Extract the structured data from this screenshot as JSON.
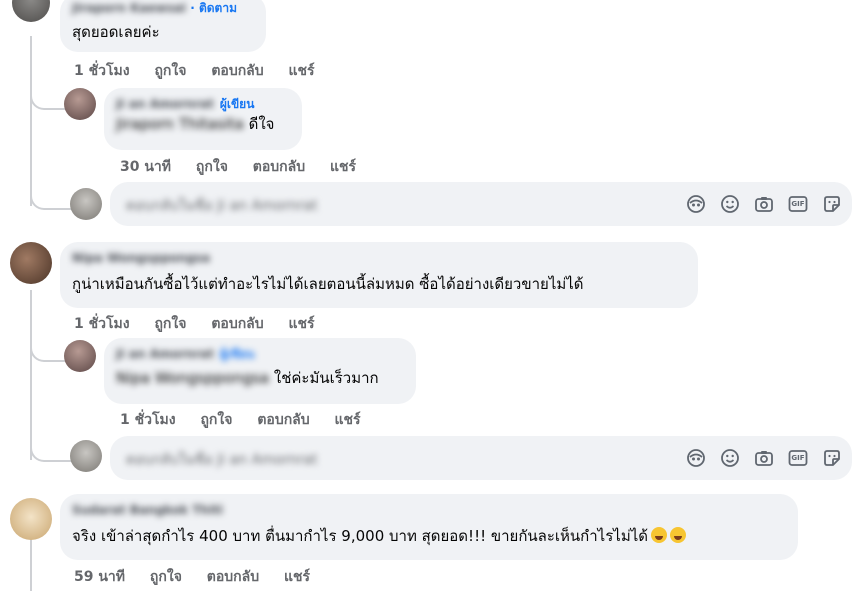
{
  "comments": [
    {
      "id": "c1",
      "author": "Jiraporn Kaewsai",
      "follow_label": "· ติดตาม",
      "text": "สุดยอดเลยค่ะ",
      "time": "1 ชั่วโมง",
      "actions": [
        "ถูกใจ",
        "ตอบกลับ",
        "แชร์"
      ]
    },
    {
      "id": "r1",
      "author": "Ji an Amornrat",
      "role": "ผู้เขียน",
      "mention": "Jiraporn Thitasita",
      "text": "ดีใจ",
      "time": "30 นาที",
      "actions": [
        "ถูกใจ",
        "ตอบกลับ",
        "แชร์"
      ]
    },
    {
      "id": "c2",
      "author": "Nipa Wongsppongsa",
      "text": "กูน่าเหมือนกันซื้อไว้แต่ทำอะไรไม่ได้เลยตอนนี้ล่มหมด ซื้อได้อย่างเดียวขายไม่ได้",
      "time": "1 ชั่วโมง",
      "actions": [
        "ถูกใจ",
        "ตอบกลับ",
        "แชร์"
      ]
    },
    {
      "id": "r2",
      "author": "Ji an Amornrat",
      "role": "ผู้เขียน",
      "mention": "Nipa Wongsppongsa",
      "text": "ใช่ค่ะมันเร็วมาก",
      "time": "1 ชั่วโมง",
      "actions": [
        "ถูกใจ",
        "ตอบกลับ",
        "แชร์"
      ]
    },
    {
      "id": "c3",
      "author": "Sudarat Bangkok Thiti",
      "text": "จริง เข้าล่าสุดกำไร 400 บาท ตื่นมากำไร 9,000 บาท สุดยอด!!! ขายกันละเห็นกำไรไม่ได้",
      "time": "59 นาที",
      "actions": [
        "ถูกใจ",
        "ตอบกลับ",
        "แชร์"
      ]
    }
  ],
  "reply_boxes": [
    {
      "placeholder": "ตอบกลับในชื่อ Ji an Amornrat"
    },
    {
      "placeholder": "ตอบกลับในชื่อ Ji an Amornrat"
    }
  ],
  "composer_icons": [
    "avatar-sticker-icon",
    "emoji-icon",
    "camera-icon",
    "gif-icon",
    "sticker-icon"
  ],
  "composer_icon_labels": {
    "gif": "GIF"
  },
  "colors": {
    "bubble": "#f0f2f5",
    "muted": "#65676b",
    "link": "#1877f2",
    "thread": "#ced0d4"
  }
}
